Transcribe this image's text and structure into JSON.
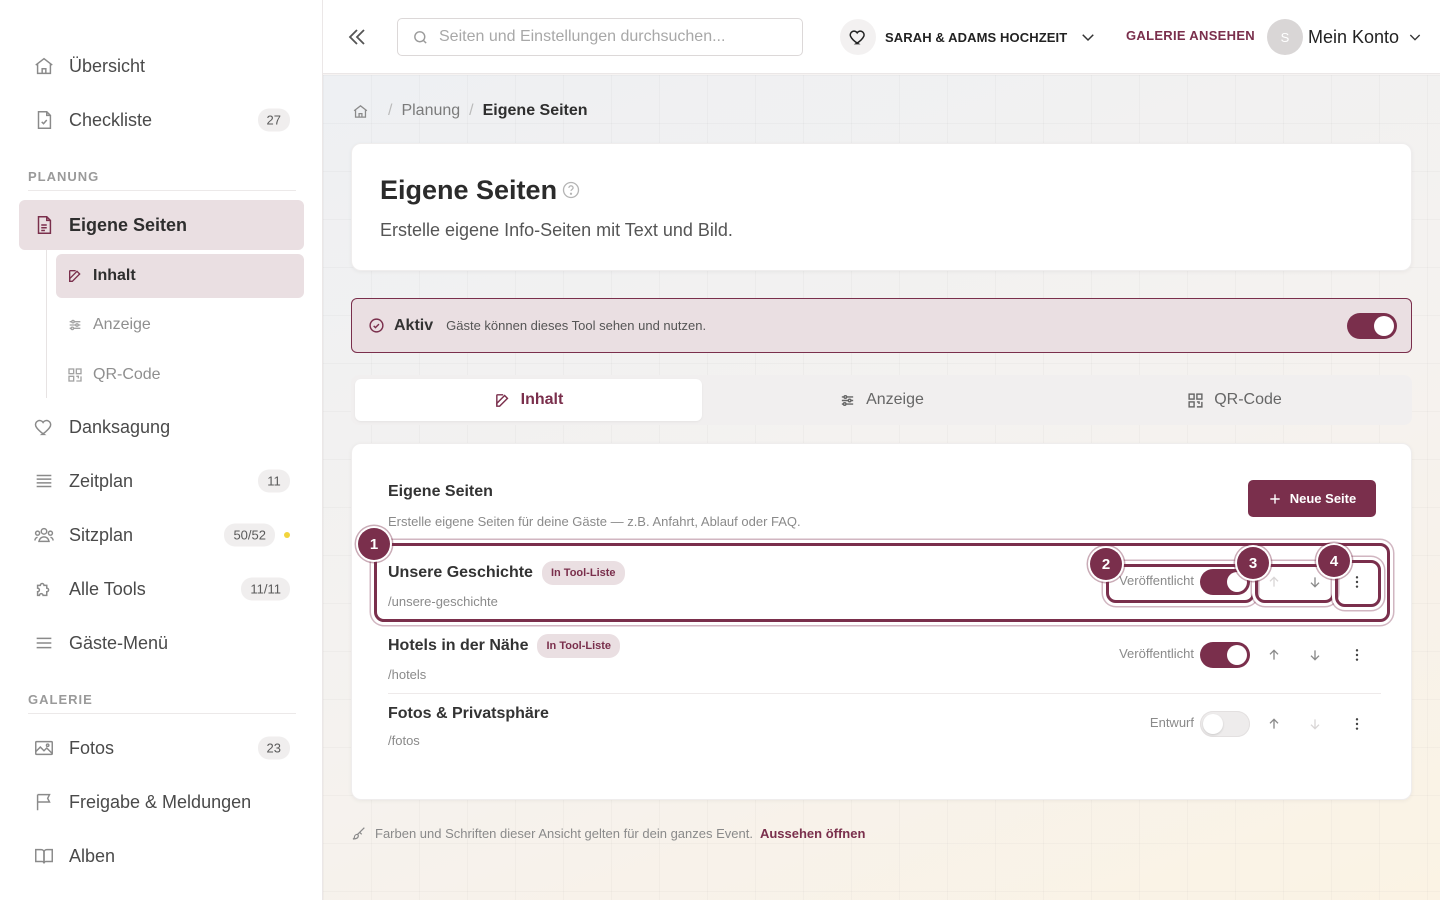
{
  "sidebar": {
    "top_items": [
      {
        "label": "Übersicht",
        "icon": "home-icon"
      },
      {
        "label": "Checkliste",
        "icon": "checklist-icon",
        "badge": "27"
      }
    ],
    "section_planung": "PLANUNG",
    "planung_items": [
      {
        "label": "Eigene Seiten",
        "icon": "page-icon",
        "active": true
      },
      {
        "label": "Danksagung",
        "icon": "heart-icon"
      },
      {
        "label": "Zeitplan",
        "icon": "list-icon",
        "badge": "11"
      },
      {
        "label": "Sitzplan",
        "icon": "users-icon",
        "badge": "50/52",
        "dot": true
      },
      {
        "label": "Alle Tools",
        "icon": "puzzle-icon",
        "badge": "11/11"
      },
      {
        "label": "Gäste-Menü",
        "icon": "menu-icon"
      }
    ],
    "sub_items": [
      {
        "label": "Inhalt",
        "icon": "edit-icon",
        "active": true
      },
      {
        "label": "Anzeige",
        "icon": "sliders-icon"
      },
      {
        "label": "QR-Code",
        "icon": "qr-icon"
      }
    ],
    "section_galerie": "GALERIE",
    "galerie_items": [
      {
        "label": "Fotos",
        "icon": "image-icon",
        "badge": "23"
      },
      {
        "label": "Freigabe & Meldungen",
        "icon": "flag-icon"
      },
      {
        "label": "Alben",
        "icon": "book-icon"
      }
    ]
  },
  "header": {
    "search_placeholder": "Seiten und Einstellungen durchsuchen...",
    "event_name": "SARAH & ADAMS HOCHZEIT",
    "gallery_link": "GALERIE ANSEHEN",
    "avatar_initial": "S",
    "account_label": "Mein Konto"
  },
  "breadcrumb": {
    "items": [
      "Planung",
      "Eigene Seiten"
    ]
  },
  "title_card": {
    "title": "Eigene Seiten",
    "description": "Erstelle eigene Info-Seiten mit Text und Bild."
  },
  "active_bar": {
    "title": "Aktiv",
    "description": "Gäste können dieses Tool sehen und nutzen.",
    "enabled": true
  },
  "tabs": [
    {
      "label": "Inhalt",
      "icon": "edit-icon",
      "active": true
    },
    {
      "label": "Anzeige",
      "icon": "sliders-icon"
    },
    {
      "label": "QR-Code",
      "icon": "qr-icon"
    }
  ],
  "pages_card": {
    "title": "Eigene Seiten",
    "description": "Erstelle eigene Seiten für deine Gäste — z.B. Anfahrt, Ablauf oder FAQ.",
    "new_button": "Neue Seite",
    "rows": [
      {
        "name": "Unsere Geschichte",
        "badge": "In Tool-Liste",
        "path": "/unsere-geschichte",
        "status": "Veröffentlicht",
        "published": true,
        "up_enabled": false,
        "down_enabled": true
      },
      {
        "name": "Hotels in der Nähe",
        "badge": "In Tool-Liste",
        "path": "/hotels",
        "status": "Veröffentlicht",
        "published": true,
        "up_enabled": true,
        "down_enabled": true
      },
      {
        "name": "Fotos & Privatsphäre",
        "badge": "",
        "path": "/fotos",
        "status": "Entwurf",
        "published": false,
        "up_enabled": true,
        "down_enabled": false
      }
    ]
  },
  "highlights": [
    "1",
    "2",
    "3",
    "4"
  ],
  "footer": {
    "text": "Farben und Schriften dieser Ansicht gelten für dein ganzes Event.",
    "link": "Aussehen öffnen"
  },
  "colors": {
    "accent": "#7a2f4c",
    "accent_light": "#eadfe2",
    "badge_dot": "#f2d43d"
  }
}
